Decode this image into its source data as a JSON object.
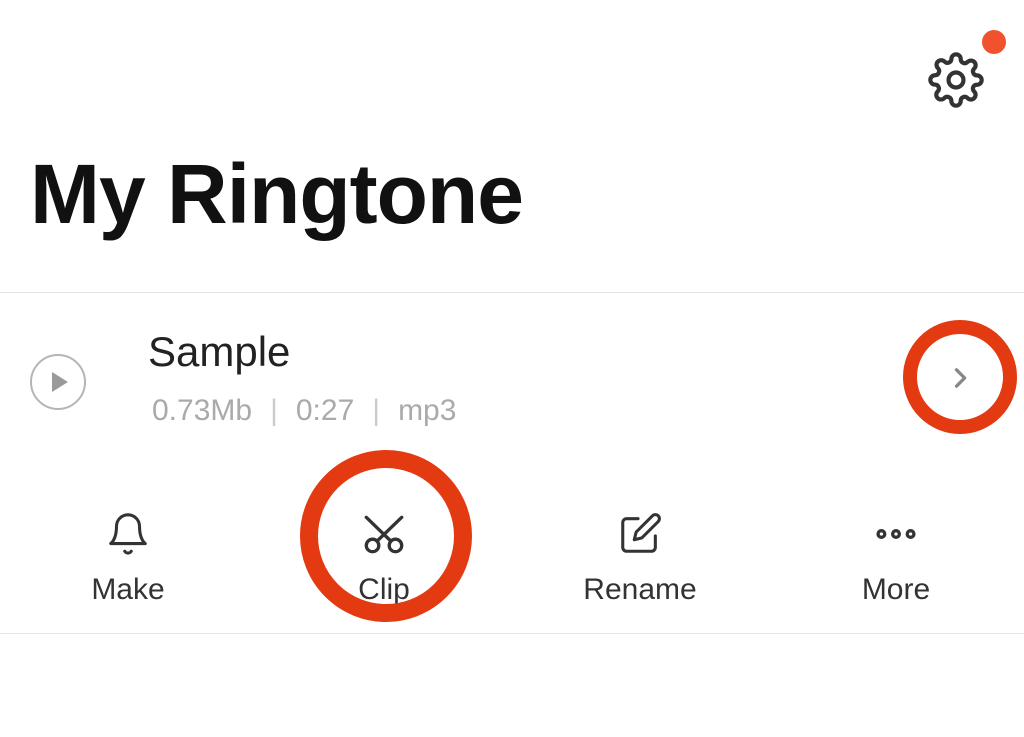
{
  "title": "My Ringtone",
  "item": {
    "name": "Sample",
    "size": "0.73Mb",
    "duration": "0:27",
    "format": "mp3"
  },
  "actions": {
    "make": "Make",
    "clip": "Clip",
    "rename": "Rename",
    "more": "More"
  },
  "colors": {
    "accent": "#e43a12",
    "dot": "#f0522d"
  }
}
